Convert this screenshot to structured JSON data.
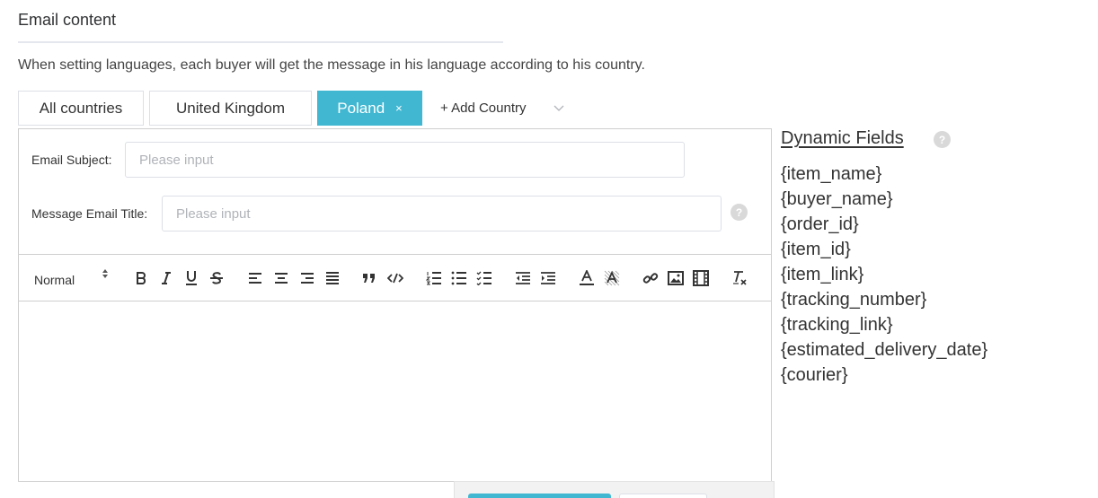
{
  "section": {
    "title": "Email content",
    "note": "When setting languages, each buyer will get the message in his language according to his country."
  },
  "tabs": [
    {
      "label": "All countries",
      "active": false
    },
    {
      "label": "United Kingdom",
      "active": false
    },
    {
      "label": "Poland",
      "active": true,
      "close_glyph": "×"
    }
  ],
  "add_country": {
    "label": "+ Add Country",
    "icon": "chevron-down-icon"
  },
  "form": {
    "subject": {
      "label": "Email Subject:",
      "placeholder": "Please input",
      "value": ""
    },
    "title": {
      "label": "Message Email Title:",
      "placeholder": "Please input",
      "value": "",
      "help": "?"
    }
  },
  "toolbar": {
    "header_select": "Normal",
    "icons": [
      "bold-icon",
      "italic-icon",
      "underline-icon",
      "strike-icon",
      "align-left-icon",
      "align-center-icon",
      "align-right-icon",
      "align-justify-icon",
      "blockquote-icon",
      "code-block-icon",
      "ordered-list-icon",
      "bullet-list-icon",
      "check-list-icon",
      "indent-decrease-icon",
      "indent-increase-icon",
      "text-color-icon",
      "background-color-icon",
      "link-icon",
      "image-icon",
      "video-icon",
      "clear-format-icon"
    ]
  },
  "dynamic_fields": {
    "title": "Dynamic Fields",
    "help": "?",
    "items": [
      "{item_name}",
      "{buyer_name}",
      "{order_id}",
      "{item_id}",
      "{item_link}",
      "{tracking_number}",
      "{tracking_link}",
      "{estimated_delivery_date}",
      "{courier}"
    ]
  },
  "colors": {
    "accent": "#41b7d2",
    "border": "#cfcfcf",
    "help_dot": "#d9d9d9"
  }
}
